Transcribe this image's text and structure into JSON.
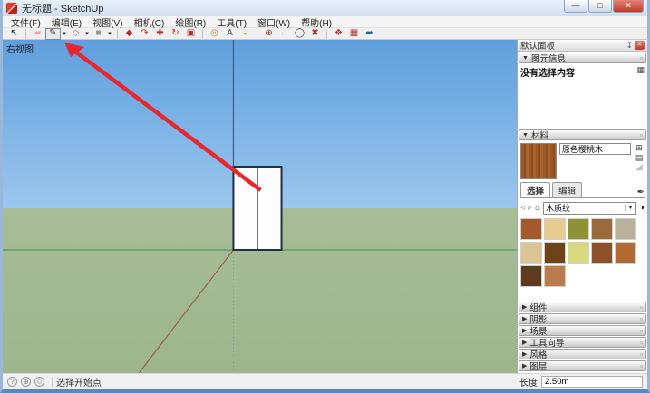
{
  "window": {
    "title": "无标题 - SketchUp",
    "controls": {
      "minimize": "—",
      "maximize": "□",
      "close": "✕"
    }
  },
  "menu": {
    "items": [
      {
        "name": "menu-file",
        "label": "文件(F)"
      },
      {
        "name": "menu-edit",
        "label": "编辑(E)"
      },
      {
        "name": "menu-view",
        "label": "视图(V)"
      },
      {
        "name": "menu-camera",
        "label": "相机(C)"
      },
      {
        "name": "menu-draw",
        "label": "绘图(R)"
      },
      {
        "name": "menu-tools",
        "label": "工具(T)"
      },
      {
        "name": "menu-window",
        "label": "窗口(W)"
      },
      {
        "name": "menu-help",
        "label": "帮助(H)"
      }
    ]
  },
  "toolbar": {
    "items": [
      {
        "type": "tool",
        "name": "select-tool-icon",
        "glyph": "↖",
        "color": "#1a1a1a"
      },
      {
        "type": "sep"
      },
      {
        "type": "tool",
        "name": "eraser-tool-icon",
        "glyph": "▰",
        "color": "#e79cb1"
      },
      {
        "type": "tool",
        "name": "line-tool-icon",
        "glyph": "✎",
        "color": "#7a2a1a",
        "selected": true,
        "dropdown": true
      },
      {
        "type": "tool",
        "name": "shapes-tool-icon",
        "glyph": "◇",
        "color": "#c2607a",
        "dropdown": true
      },
      {
        "type": "tool",
        "name": "rectangle-tool-icon",
        "glyph": "■",
        "color": "#8d939c",
        "dropdown": true
      },
      {
        "type": "sep"
      },
      {
        "type": "tool",
        "name": "push-pull-tool-icon",
        "glyph": "◆",
        "color": "#b23131"
      },
      {
        "type": "tool",
        "name": "follow-me-tool-icon",
        "glyph": "↷",
        "color": "#b23131"
      },
      {
        "type": "tool",
        "name": "move-tool-icon",
        "glyph": "✚",
        "color": "#b23131"
      },
      {
        "type": "tool",
        "name": "rotate-tool-icon",
        "glyph": "↻",
        "color": "#b23131"
      },
      {
        "type": "tool",
        "name": "offset-tool-icon",
        "glyph": "▣",
        "color": "#b23131"
      },
      {
        "type": "sep"
      },
      {
        "type": "tool",
        "name": "tape-measure-tool-icon",
        "glyph": "◎",
        "color": "#b8862a"
      },
      {
        "type": "tool",
        "name": "text-tool-icon",
        "glyph": "A",
        "color": "#4a4a4a"
      },
      {
        "type": "tool",
        "name": "paint-bucket-tool-icon",
        "glyph": "◒",
        "color": "#c9a227"
      },
      {
        "type": "sep"
      },
      {
        "type": "tool",
        "name": "orbit-tool-icon",
        "glyph": "⊕",
        "color": "#b23131"
      },
      {
        "type": "tool",
        "name": "pan-tool-icon",
        "glyph": "↔",
        "color": "#c89b6e"
      },
      {
        "type": "tool",
        "name": "zoom-tool-icon",
        "glyph": "◯",
        "color": "#3a3a3a"
      },
      {
        "type": "tool",
        "name": "zoom-extents-tool-icon",
        "glyph": "✖",
        "color": "#b23131"
      },
      {
        "type": "sep"
      },
      {
        "type": "tool",
        "name": "make-component-tool-icon",
        "glyph": "❖",
        "color": "#b23131"
      },
      {
        "type": "tool",
        "name": "3d-warehouse-tool-icon",
        "glyph": "▦",
        "color": "#b23131"
      },
      {
        "type": "tool",
        "name": "extension-warehouse-tool-icon",
        "glyph": "➦",
        "color": "#2a5db0"
      }
    ]
  },
  "viewport": {
    "view_label": "右视图",
    "colors": {
      "blue_axis": "#3c5d8c",
      "blue_axis_dotted": "#7e8ea6",
      "green_axis": "#4f9b52",
      "red_axis": "#9e5a48",
      "box_stroke": "#1f2e40",
      "box_fill": "#fdfdfd",
      "box_edge": "#777777",
      "arrow": "#e8262e"
    }
  },
  "panel": {
    "tray_title": "默认面板",
    "entity_info": {
      "title": "图元信息",
      "empty_text": "没有选择内容"
    },
    "materials": {
      "title": "材料",
      "name": "原色樱桃木",
      "tabs": [
        "选择",
        "编辑"
      ],
      "category": "木质纹",
      "preview_color": "#9c5826",
      "swatches": [
        {
          "color": "#a4592a"
        },
        {
          "color": "#e6cd8f"
        },
        {
          "color": "#8e9135"
        },
        {
          "color": "#9a6a3c"
        },
        {
          "color": "#b7b299"
        },
        {
          "color": "#dbc593"
        },
        {
          "color": "#6e4318"
        },
        {
          "color": "#d8d87e"
        },
        {
          "color": "#8e4f2b"
        },
        {
          "color": "#b26a31"
        },
        {
          "color": "#5e3a20"
        },
        {
          "color": "#ba7c4c"
        }
      ]
    },
    "sections": [
      {
        "name": "section-components",
        "label": "组件"
      },
      {
        "name": "section-shadows",
        "label": "阴影"
      },
      {
        "name": "section-scenes",
        "label": "场景"
      },
      {
        "name": "section-instructor",
        "label": "工具向导"
      },
      {
        "name": "section-styles",
        "label": "风格"
      },
      {
        "name": "section-layers",
        "label": "图层"
      }
    ]
  },
  "statusbar": {
    "icons": [
      {
        "name": "geolocate-icon",
        "glyph": "?"
      },
      {
        "name": "credits-icon",
        "glyph": "⊕"
      },
      {
        "name": "signin-icon",
        "glyph": "☺"
      }
    ],
    "hint": "选择开始点",
    "measure_label": "长度",
    "measure_value": "2.50m"
  }
}
